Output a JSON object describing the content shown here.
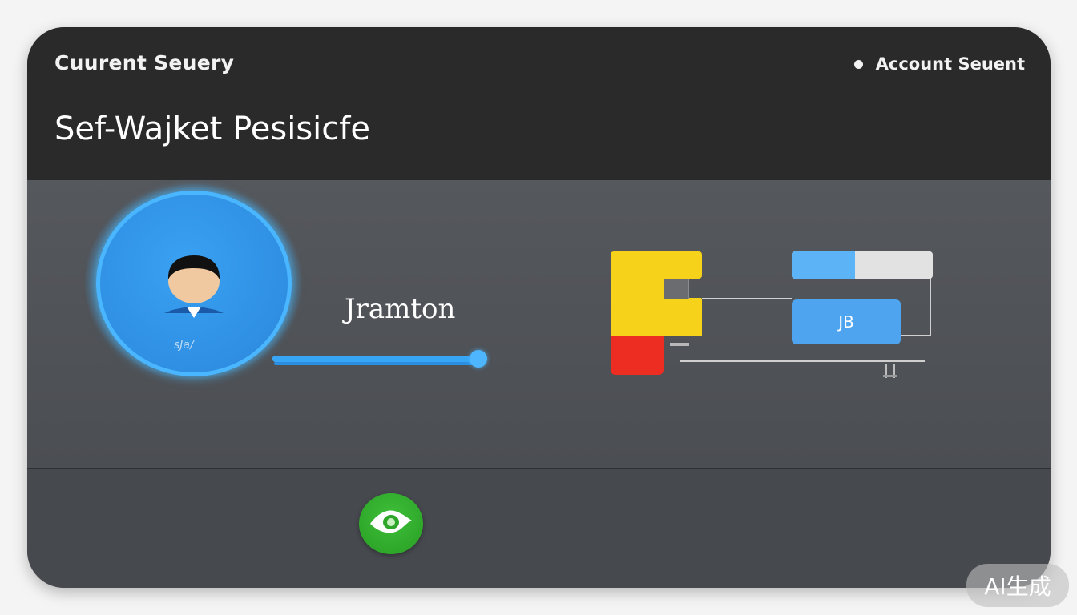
{
  "header": {
    "section_title": "Cuurent Seuery",
    "account_label": "Account Seuent",
    "page_title": "Sef-Wajket Pesisicfe"
  },
  "profile": {
    "user_name": "Jramton",
    "avatar_signature": "sJa/",
    "slider_value_percent": 100
  },
  "widget": {
    "progress_percent": 45,
    "action_button_label": "JB",
    "colors": {
      "yellow": "#f6d21b",
      "red": "#ee2d22",
      "blue": "#4ea4ee",
      "progress_fill": "#5cb3f5"
    }
  },
  "footer": {
    "eye_button_icon": "eye-icon",
    "eye_button_color": "#2ea629"
  },
  "watermark": "AI生成"
}
